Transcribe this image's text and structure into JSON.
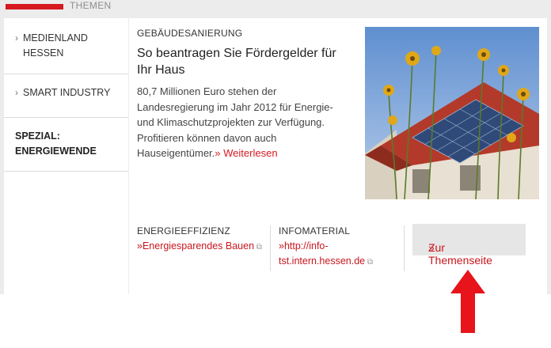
{
  "header": {
    "label": "THEMEN",
    "accent": "#d71920"
  },
  "sidebar": {
    "items": [
      {
        "label": "MEDIENLAND HESSEN",
        "chevron": "›"
      },
      {
        "label": "SMART INDUSTRY",
        "chevron": "›"
      },
      {
        "label": "SPEZIAL: ENERGIEWENDE"
      }
    ]
  },
  "article": {
    "kicker": "GEBÄUDESANIERUNG",
    "headline": "So beantragen Sie Fördergelder für Ihr Haus",
    "teaser": "80,7 Millionen Euro stehen der Landesregierung im Jahr 2012 für Energie- und Klimaschutzprojekten zur Verfügung. Profitieren können davon auch Hauseigentümer.",
    "more_prefix": "»",
    "more_label": "Weiterlesen",
    "image_icon": "solar-house-photo"
  },
  "links": [
    {
      "heading": "ENERGIEEFFIZIENZ",
      "prefix": "»",
      "label": "Energiesparendes Bauen",
      "icon": "external-link-icon"
    },
    {
      "heading": "INFOMATERIAL",
      "prefix": "»",
      "label": "http://info-tst.intern.hessen.de",
      "icon": "external-link-icon"
    }
  ],
  "cta": {
    "prefix": "»",
    "label": "Zur Themenseite"
  },
  "annotation": {
    "icon": "red-arrow-up",
    "color": "#e8141b"
  }
}
